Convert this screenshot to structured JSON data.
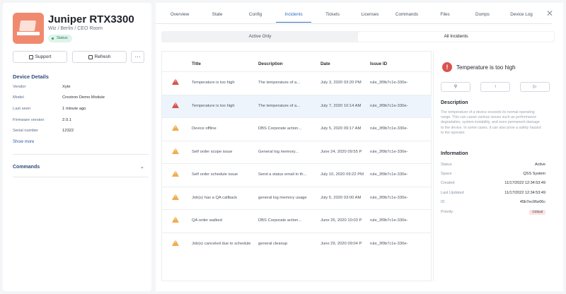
{
  "device": {
    "title": "Juniper RTX3300",
    "subtitle": "Wiz / Berlin / CEO Room",
    "status": "Status",
    "support_label": "Support",
    "refresh_label": "Refresh",
    "more_label": "···",
    "details_title": "Device Details",
    "details": [
      {
        "key": "Vendor",
        "value": "Xyte"
      },
      {
        "key": "Model",
        "value": "Crestron Demo Module"
      },
      {
        "key": "Last seen",
        "value": "1 minute ago"
      },
      {
        "key": "Firmware version",
        "value": "2.0.1"
      },
      {
        "key": "Serial number",
        "value": "12322"
      }
    ],
    "show_more": "Show more",
    "commands": "Commands"
  },
  "tabs": [
    "Overview",
    "State",
    "Config",
    "Incidents",
    "Tickets",
    "Licenses",
    "Commands",
    "Files",
    "Dumps",
    "Device Log"
  ],
  "active_tab": "Incidents",
  "filter": {
    "active_only": "Active Only",
    "all": "All Incidents"
  },
  "table": {
    "headers": [
      "Title",
      "Description",
      "Date",
      "Issue ID"
    ],
    "rows": [
      {
        "severity": "critical",
        "title": "Temperature is too high",
        "desc": "The temperature of a...",
        "date": "July 3, 2020 03:20 PM",
        "id": "rule_3f9b7c1e-330e-"
      },
      {
        "severity": "critical",
        "title": "Temperature is too high",
        "desc": "The temperature of a...",
        "date": "July 7, 2020 10:14 AM",
        "id": "rule_3f9b7c1e-330e-"
      },
      {
        "severity": "major",
        "title": "Device offline",
        "desc": "DBS Corporate action...",
        "date": "July 5, 2020 09:17 AM",
        "id": "rule_3f9b7c1e-330e-"
      },
      {
        "severity": "major",
        "title": "Self order scope issue",
        "desc": "General log memory...",
        "date": "June 24, 2020 09:55 P",
        "id": "rule_3f9b7c1e-330e-"
      },
      {
        "severity": "major",
        "title": "Self order schedule issue",
        "desc": "Send a status email in th...",
        "date": "July 10, 2020 09:22 PM",
        "id": "rule_3f9b7c1e-330e-"
      },
      {
        "severity": "major",
        "title": "Job(s) has a QA callback",
        "desc": "general log memory usage",
        "date": "July 5, 2020 03:00 AM",
        "id": "rule_3f9b7c1e-330e-"
      },
      {
        "severity": "major",
        "title": "QA order walked",
        "desc": "DBS Corporate action...",
        "date": "June 26, 2020 10:03 P",
        "id": "rule_3f9b7c1e-330e-"
      },
      {
        "severity": "major",
        "title": "Job(s) canceled due to schedule",
        "desc": "general cleanup",
        "date": "June 29, 2020 09:04 P",
        "id": "rule_3f9b7c1e-330e-"
      }
    ]
  },
  "detail": {
    "title": "Temperature is too high",
    "description_heading": "Description",
    "description": "The temperature of a device exceeds its normal operating range. This can cause various issues such as performance degradation, system instability, and even permanent damage to the device. In some cases, it can also pose a safety hazard to the operator.",
    "info_heading": "Information",
    "info": [
      {
        "key": "Status",
        "value": "Active"
      },
      {
        "key": "Space",
        "value": "QSS System"
      },
      {
        "key": "Created",
        "value": "11/17/2022 12:34:53:49"
      },
      {
        "key": "Last Updated",
        "value": "11/17/2022 12:34:53:49"
      },
      {
        "key": "ID",
        "value": "45b7ec06e06c"
      }
    ],
    "priority_key": "Priority",
    "priority_value": "Critical"
  }
}
